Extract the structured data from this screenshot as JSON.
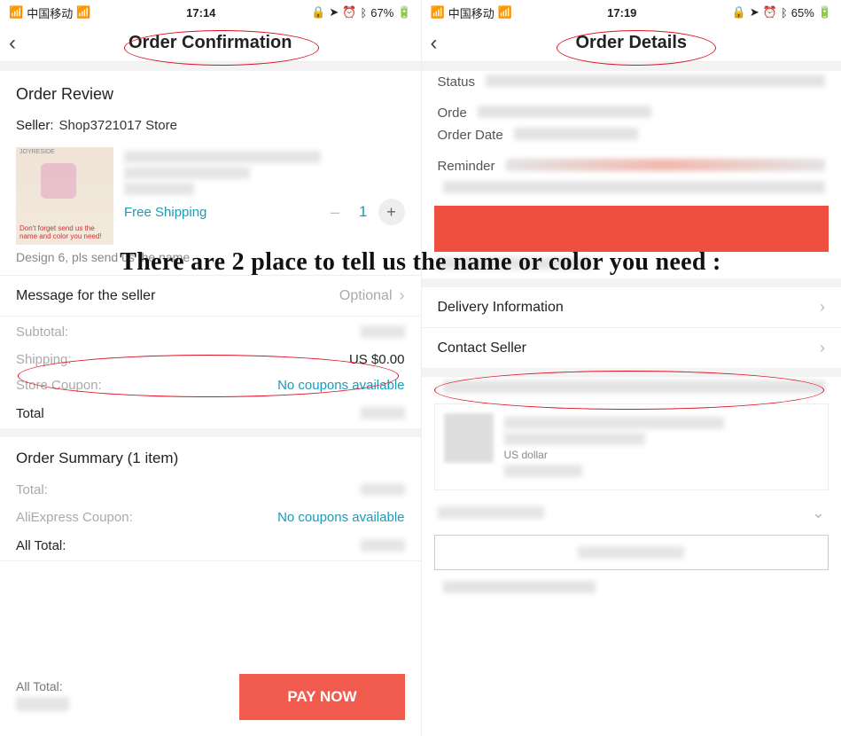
{
  "left": {
    "status": {
      "carrier": "中国移动",
      "time": "17:14",
      "battery": "67%"
    },
    "nav_title": "Order Confirmation",
    "review_title": "Order Review",
    "seller_label": "Seller:",
    "seller_name": "Shop3721017 Store",
    "thumb_note_1": "JOYRESIDE",
    "thumb_note_2": "Don't forget send us the name and color you need!",
    "free_shipping": "Free Shipping",
    "quantity": "1",
    "variant_note": "Design 6, pls send us the name",
    "msg_seller": "Message for the seller",
    "optional": "Optional",
    "subtotal_lbl": "Subtotal:",
    "shipping_lbl": "Shipping:",
    "shipping_val": "US $0.00",
    "store_coupon_lbl": "Store Coupon:",
    "no_coupons": "No coupons available",
    "total_lbl": "Total",
    "summary_title": "Order Summary (1 item)",
    "sum_total_lbl": "Total:",
    "ali_coupon_lbl": "AliExpress Coupon:",
    "all_total_lbl": "All Total:",
    "pay_all_total_lbl": "All Total:",
    "pay_btn": "PAY NOW"
  },
  "right": {
    "status": {
      "carrier": "中国移动",
      "time": "17:19",
      "battery": "65%"
    },
    "nav_title": "Order Details",
    "status_lbl": "Status",
    "order_lbl": "Orde",
    "order_date_lbl": "Order Date",
    "reminder_lbl": "Reminder",
    "delivery_info": "Delivery Information",
    "contact_seller": "Contact Seller",
    "dollar_note": "US dollar"
  },
  "overlay": "There are 2 place to tell us the name or color you need :"
}
